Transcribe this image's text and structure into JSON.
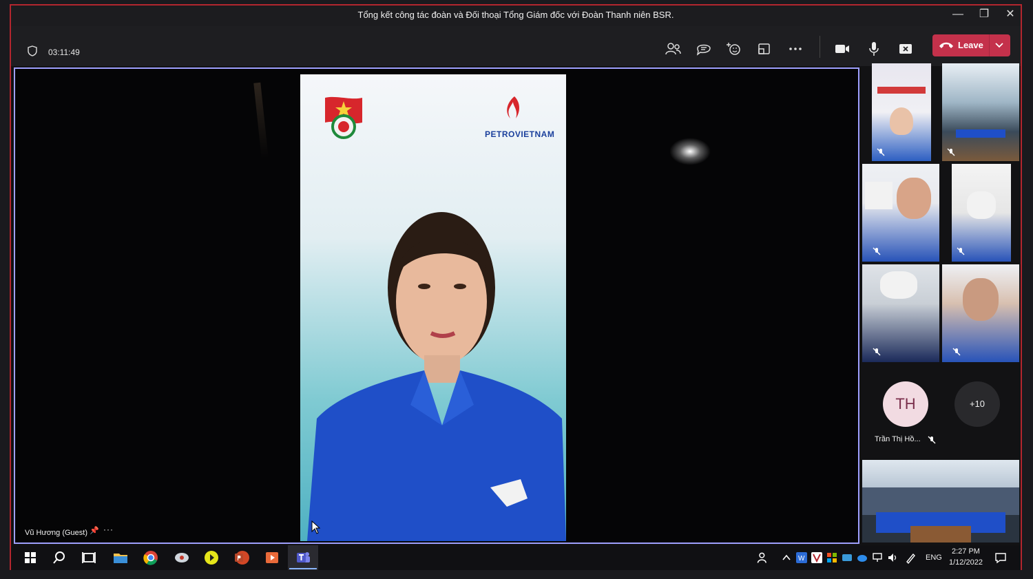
{
  "window": {
    "title": "Tổng kết công tác đoàn và Đối thoại Tổng Giám đốc với Đoàn Thanh niên BSR.",
    "minimize": "—",
    "restore": "❐",
    "close": "✕"
  },
  "toolbar": {
    "timer": "03:11:49",
    "icons": [
      "participants-icon",
      "chat-icon",
      "reactions-icon",
      "share-tray-icon",
      "more-actions-icon",
      "camera-icon",
      "microphone-icon",
      "share-screen-icon"
    ],
    "leave_label": "Leave",
    "leave_color": "#c4314b"
  },
  "stage": {
    "speaker_name": "Vũ Hương (Guest)",
    "pin_glyph": "📌",
    "more_glyph": "···",
    "logo_text": "PETROVIETNAM",
    "accent_border": "#9fa0ff"
  },
  "participants": {
    "avatar_initials": "TH",
    "avatar_name": "Trần Thị Hồ...",
    "overflow_label": "+10"
  },
  "taskbar": {
    "apps": [
      "start-icon",
      "search-icon",
      "task-view-icon",
      "file-explorer-icon",
      "chrome-icon",
      "app-icon",
      "media-player-icon",
      "powerpoint-icon",
      "video-app-icon",
      "teams-icon"
    ],
    "language": "ENG",
    "time": "2:27 PM",
    "date": "1/12/2022"
  }
}
